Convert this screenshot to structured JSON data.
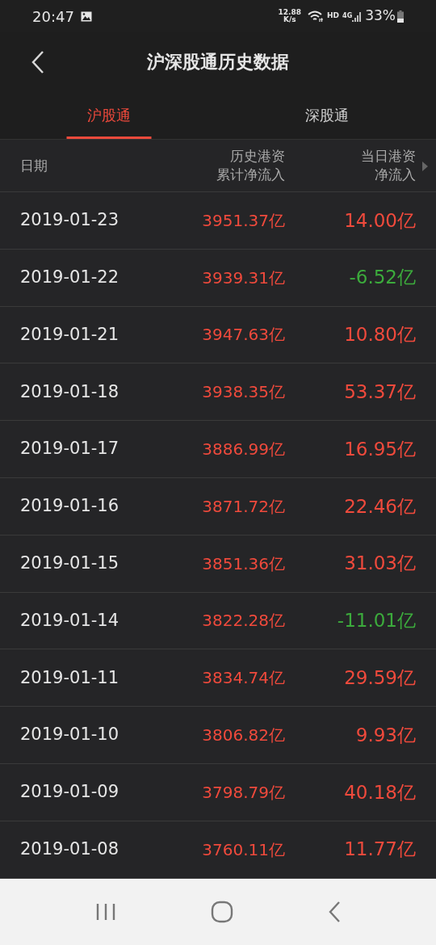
{
  "status_bar": {
    "time": "20:47",
    "speed_value": "12.88",
    "speed_unit": "K/s",
    "hd": "HD",
    "network": "4G",
    "battery": "33%"
  },
  "header": {
    "title": "沪深股通历史数据"
  },
  "tabs": [
    {
      "label": "沪股通",
      "selected": true
    },
    {
      "label": "深股通",
      "selected": false
    }
  ],
  "table": {
    "columns": [
      {
        "lines": [
          "日期"
        ]
      },
      {
        "lines": [
          "历史港资",
          "累计净流入"
        ]
      },
      {
        "lines": [
          "当日港资",
          "净流入"
        ]
      }
    ],
    "rows": [
      {
        "date": "2019-01-23",
        "cumulative": "3951.37亿",
        "daily": "14.00亿",
        "color": "#f04a3c"
      },
      {
        "date": "2019-01-22",
        "cumulative": "3939.31亿",
        "daily": "-6.52亿",
        "color": "#3cab3c"
      },
      {
        "date": "2019-01-21",
        "cumulative": "3947.63亿",
        "daily": "10.80亿",
        "color": "#f04a3c"
      },
      {
        "date": "2019-01-18",
        "cumulative": "3938.35亿",
        "daily": "53.37亿",
        "color": "#f04a3c"
      },
      {
        "date": "2019-01-17",
        "cumulative": "3886.99亿",
        "daily": "16.95亿",
        "color": "#f04a3c"
      },
      {
        "date": "2019-01-16",
        "cumulative": "3871.72亿",
        "daily": "22.46亿",
        "color": "#f04a3c"
      },
      {
        "date": "2019-01-15",
        "cumulative": "3851.36亿",
        "daily": "31.03亿",
        "color": "#f04a3c"
      },
      {
        "date": "2019-01-14",
        "cumulative": "3822.28亿",
        "daily": "-11.01亿",
        "color": "#3cab3c"
      },
      {
        "date": "2019-01-11",
        "cumulative": "3834.74亿",
        "daily": "29.59亿",
        "color": "#f04a3c"
      },
      {
        "date": "2019-01-10",
        "cumulative": "3806.82亿",
        "daily": "9.93亿",
        "color": "#f04a3c"
      },
      {
        "date": "2019-01-09",
        "cumulative": "3798.79亿",
        "daily": "40.18亿",
        "color": "#f04a3c"
      },
      {
        "date": "2019-01-08",
        "cumulative": "3760.11亿",
        "daily": "11.77亿",
        "color": "#f04a3c"
      }
    ]
  }
}
